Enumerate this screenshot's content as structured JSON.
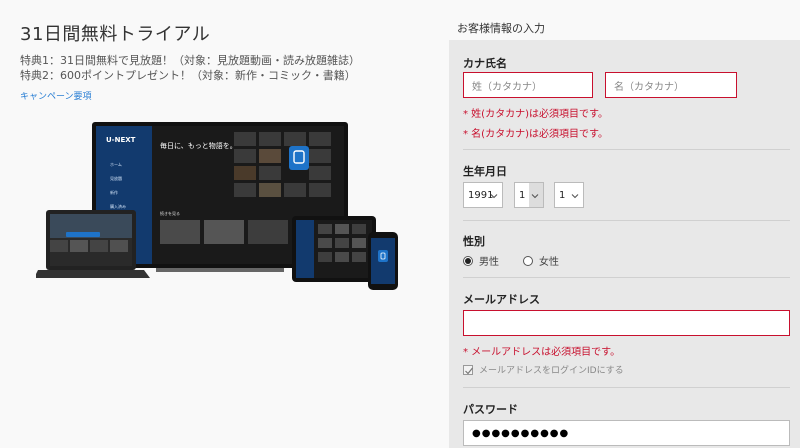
{
  "promo": {
    "title": "31日間無料トライアル",
    "benefit1": "特典1：31日間無料で見放題！（対象：見放題動画・読み放題雑誌）",
    "benefit2": "特典2：600ポイントプレゼント！（対象：新作・コミック・書籍）",
    "campaign_link": "キャンペーン要項",
    "device_image": {
      "brand": "U-NEXT",
      "tagline": "毎日に、もっと物語を。",
      "sidebar_items": [
        "ホーム",
        "見放題",
        "新作",
        "購入済み"
      ],
      "section_label": "続きを見る"
    }
  },
  "form": {
    "heading": "お客様情報の入力",
    "kana_name": {
      "title": "カナ氏名",
      "last_placeholder": "姓（カタカナ）",
      "first_placeholder": "名（カタカナ）",
      "error_last": "* 姓(カタカナ)は必須項目です。",
      "error_first": "* 名(カタカナ)は必須項目です。"
    },
    "birthdate": {
      "title": "生年月日",
      "year": "1991",
      "month": "1",
      "day": "1"
    },
    "gender": {
      "title": "性別",
      "male": "男性",
      "female": "女性",
      "selected": "male"
    },
    "email": {
      "title": "メールアドレス",
      "value": "",
      "error": "* メールアドレスは必須項目です。",
      "login_id_label": "メールアドレスをログインIDにする",
      "login_id_checked": true
    },
    "password": {
      "title": "パスワード",
      "masked_value": "●●●●●●●●●●"
    }
  },
  "colors": {
    "error_red": "#c8102e",
    "link_blue": "#2a7fd4",
    "panel_gray": "#e8e8e8"
  }
}
